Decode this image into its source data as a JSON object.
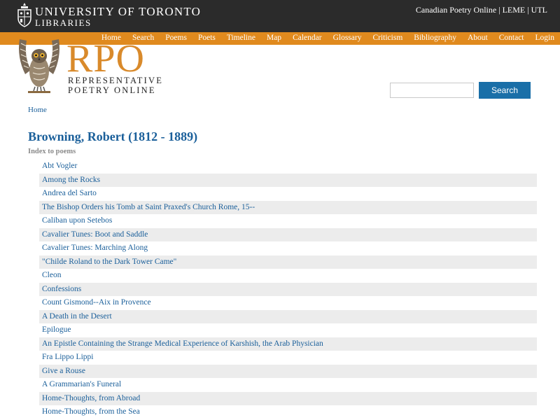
{
  "header": {
    "institution_line1": "UNIVERSITY OF TORONTO",
    "institution_line2": "LIBRARIES",
    "top_links": [
      "Canadian Poetry Online",
      "LEME",
      "UTL"
    ]
  },
  "nav": [
    "Home",
    "Search",
    "Poems",
    "Poets",
    "Timeline",
    "Map",
    "Calendar",
    "Glossary",
    "Criticism",
    "Bibliography",
    "About",
    "Contact",
    "Login"
  ],
  "logo": {
    "acronym": "RPO",
    "line1": "REPRESENTATIVE",
    "line2": "POETRY ONLINE"
  },
  "search": {
    "value": "",
    "placeholder": "",
    "button_label": "Search"
  },
  "breadcrumb": "Home",
  "page": {
    "title": "Browning, Robert (1812 - 1889)",
    "subheading": "Index to poems"
  },
  "poems": [
    "Abt Vogler",
    "Among the Rocks",
    "Andrea del Sarto",
    "The Bishop Orders his Tomb at Saint Praxed's Church Rome, 15--",
    "Caliban upon Setebos",
    "Cavalier Tunes: Boot and Saddle",
    "Cavalier Tunes: Marching Along",
    "\"Childe Roland to the Dark Tower Came\"",
    "Cleon",
    "Confessions",
    "Count Gismond--Aix in Provence",
    "A Death in the Desert",
    "Epilogue",
    "An Epistle Containing the Strange Medical Experience of Karshish, the Arab Physician",
    "Fra Lippo Lippi",
    "Give a Rouse",
    "A Grammarian's Funeral",
    "Home-Thoughts, from Abroad",
    "Home-Thoughts, from the Sea"
  ],
  "colors": {
    "top_banner": "#2b2b2b",
    "nav_orange": "#e08a1e",
    "logo_orange": "#d98a2b",
    "link_blue": "#1a5f9a",
    "button_blue": "#1a6fa8",
    "stripe_gray": "#ececec"
  }
}
